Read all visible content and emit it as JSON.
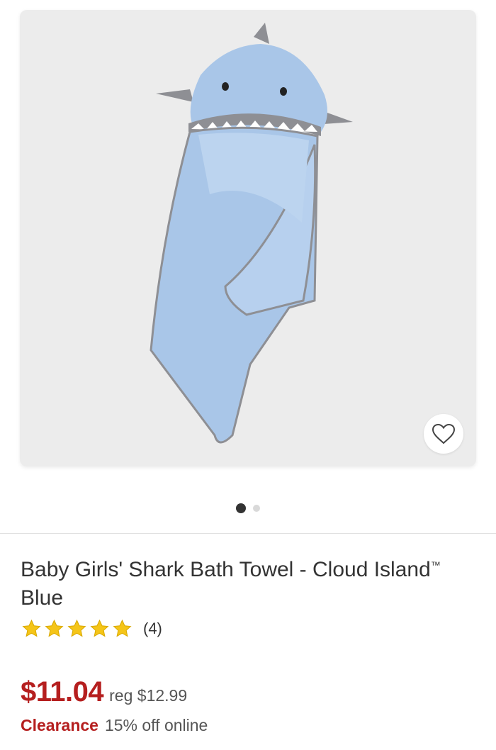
{
  "product": {
    "image_alt": "shark-hooded-towel",
    "title": "Baby Girls' Shark Bath Towel - Cloud Island",
    "trademark": "™",
    "color_suffix": " Blue",
    "rating": {
      "stars": 5,
      "review_count": "(4)",
      "star_color": "#f5c518"
    },
    "price": {
      "current": "$11.04",
      "regular": "reg $12.99",
      "color": "#b51f1f"
    },
    "promo": {
      "label": "Clearance",
      "text": "15% off online"
    }
  },
  "carousel": {
    "total": 2,
    "active_index": 0
  },
  "icons": {
    "favorite": "heart-outline-icon",
    "star": "star-icon"
  }
}
